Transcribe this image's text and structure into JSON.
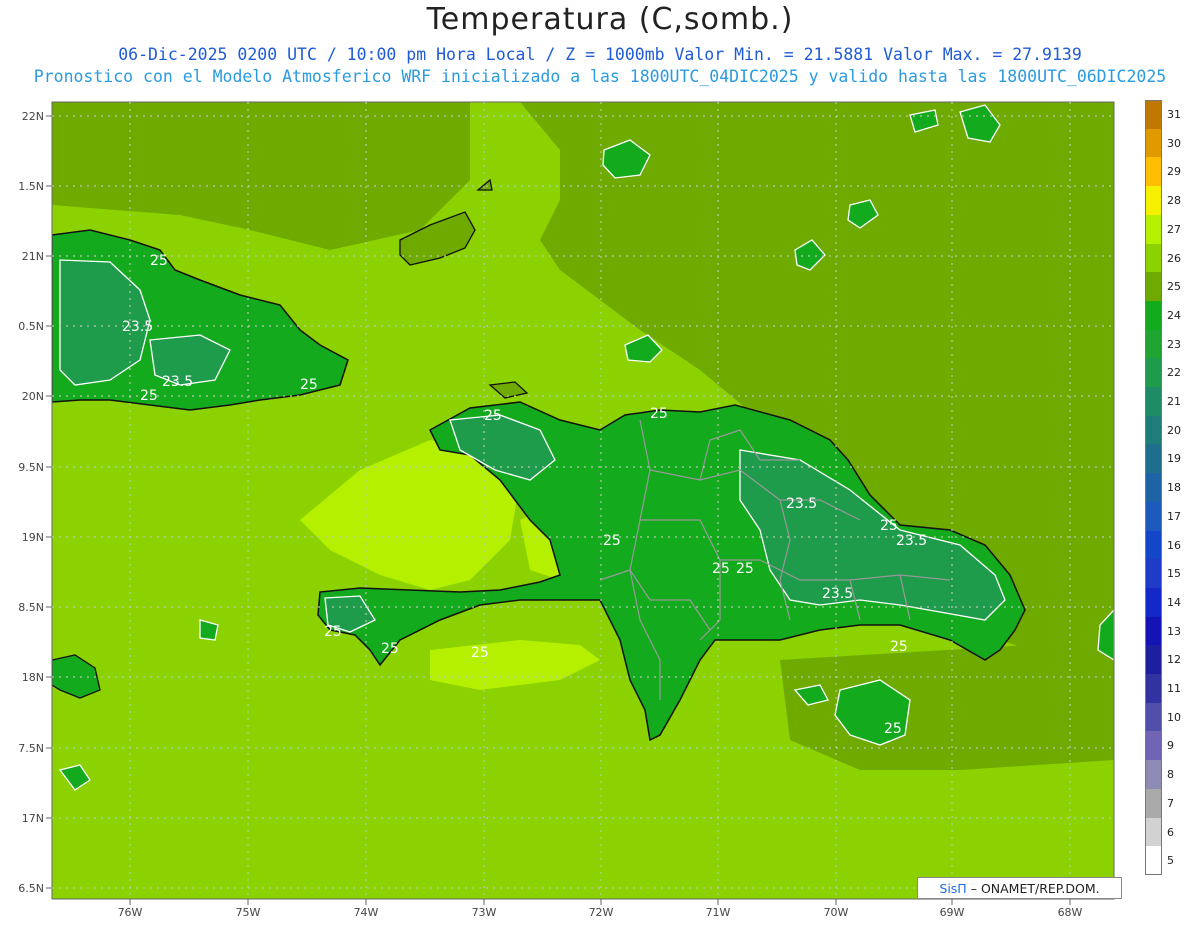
{
  "title": "Temperatura (C,somb.)",
  "subtitle_line1": "06-Dic-2025 0200 UTC / 10:00 pm Hora Local / Z = 1000mb  Valor Min. = 21.5881  Valor Max. = 27.9139",
  "subtitle_line2": "Pronostico con el Modelo Atmosferico WRF inicializado a las 1800UTC_04DIC2025 y valido hasta las  1800UTC_06DIC2025",
  "y_axis_labels": [
    "22N",
    "1.5N",
    "21N",
    "0.5N",
    "20N",
    "9.5N",
    "19N",
    "8.5N",
    "18N",
    "7.5N",
    "17N",
    "6.5N"
  ],
  "x_axis_labels": [
    "76W",
    "75W",
    "74W",
    "73W",
    "72W",
    "71W",
    "70W",
    "69W",
    "68W"
  ],
  "colorbar": {
    "levels": [
      "31",
      "30",
      "29",
      "28",
      "27",
      "26",
      "25",
      "24",
      "23",
      "22",
      "21",
      "20",
      "19",
      "18",
      "17",
      "16",
      "15",
      "14",
      "13",
      "12",
      "11",
      "10",
      "9",
      "8",
      "7",
      "6",
      "5"
    ],
    "colors": [
      "#c07800",
      "#e09a00",
      "#ffbe00",
      "#f5f000",
      "#b4f000",
      "#8cd200",
      "#6eaa00",
      "#14aa1e",
      "#1ea532",
      "#1e9b4b",
      "#1e8c64",
      "#1e7d78",
      "#1e6e8c",
      "#1e64a5",
      "#1e5abe",
      "#1446c8",
      "#1e3cc8",
      "#1428c8",
      "#1414b4",
      "#1e1ea0",
      "#3232a0",
      "#5050aa",
      "#7064b4",
      "#8c8cb4",
      "#aaaaaa",
      "#d2d2d2",
      "#ffffff"
    ]
  },
  "field_colors": {
    "sea_light": "#8cd200",
    "sea_dark": "#6eaa00",
    "land": "#14aa1e",
    "warm": "#b4f000"
  },
  "contour_labels": [
    "25",
    "23.5"
  ],
  "credit": {
    "brand": "SisΠ",
    "text": "– ONAMET/REP.DOM."
  }
}
